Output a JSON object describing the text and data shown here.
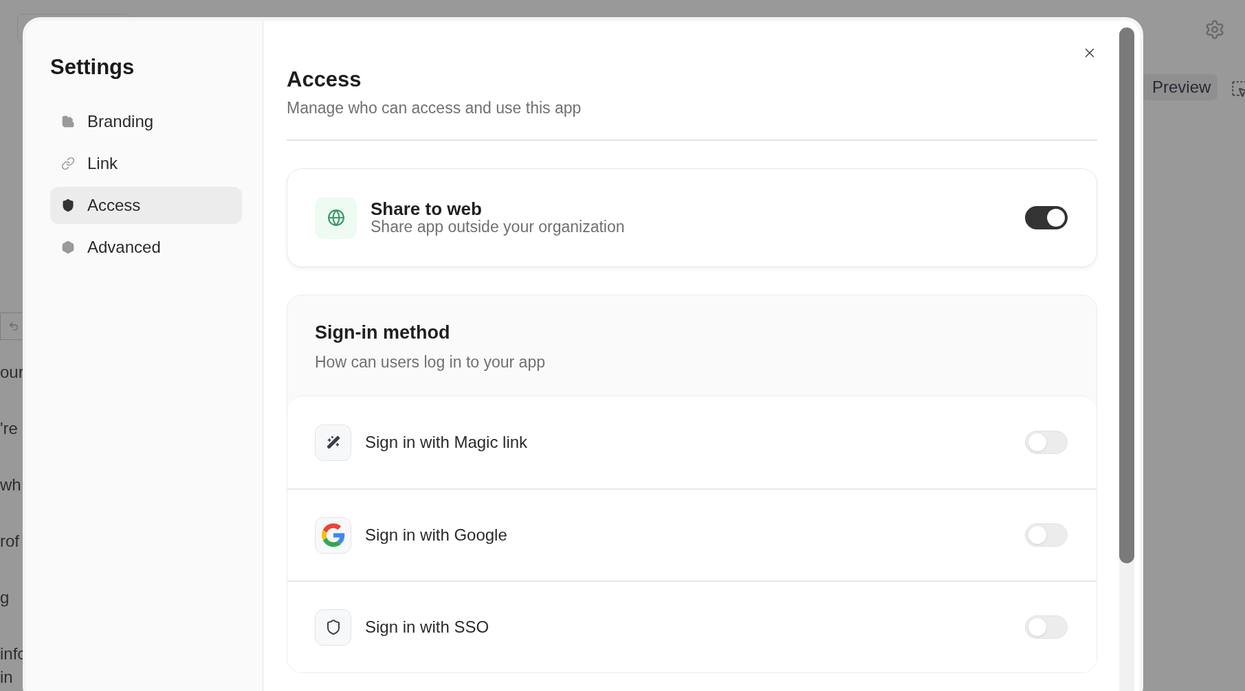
{
  "background": {
    "left_fragments": [
      "our",
      "'re",
      "wh",
      "rof",
      "g",
      "infc",
      "in"
    ],
    "preview_button": {
      "label": "Preview"
    }
  },
  "dialog": {
    "title": "Settings",
    "nav": [
      {
        "label": "Branding",
        "selected": false
      },
      {
        "label": "Link",
        "selected": false
      },
      {
        "label": "Access",
        "selected": true
      },
      {
        "label": "Advanced",
        "selected": false
      }
    ],
    "section": {
      "title": "Access",
      "subtitle": "Manage who can access and use this app"
    },
    "share_card": {
      "title": "Share to web",
      "subtitle": "Share app outside your organization",
      "on": true
    },
    "sign_in": {
      "title": "Sign-in method",
      "subtitle": "How can users log in to your app",
      "methods": [
        {
          "label": "Sign in with Magic link",
          "on": false
        },
        {
          "label": "Sign in with Google",
          "on": false
        },
        {
          "label": "Sign in with SSO",
          "on": false
        }
      ]
    }
  }
}
